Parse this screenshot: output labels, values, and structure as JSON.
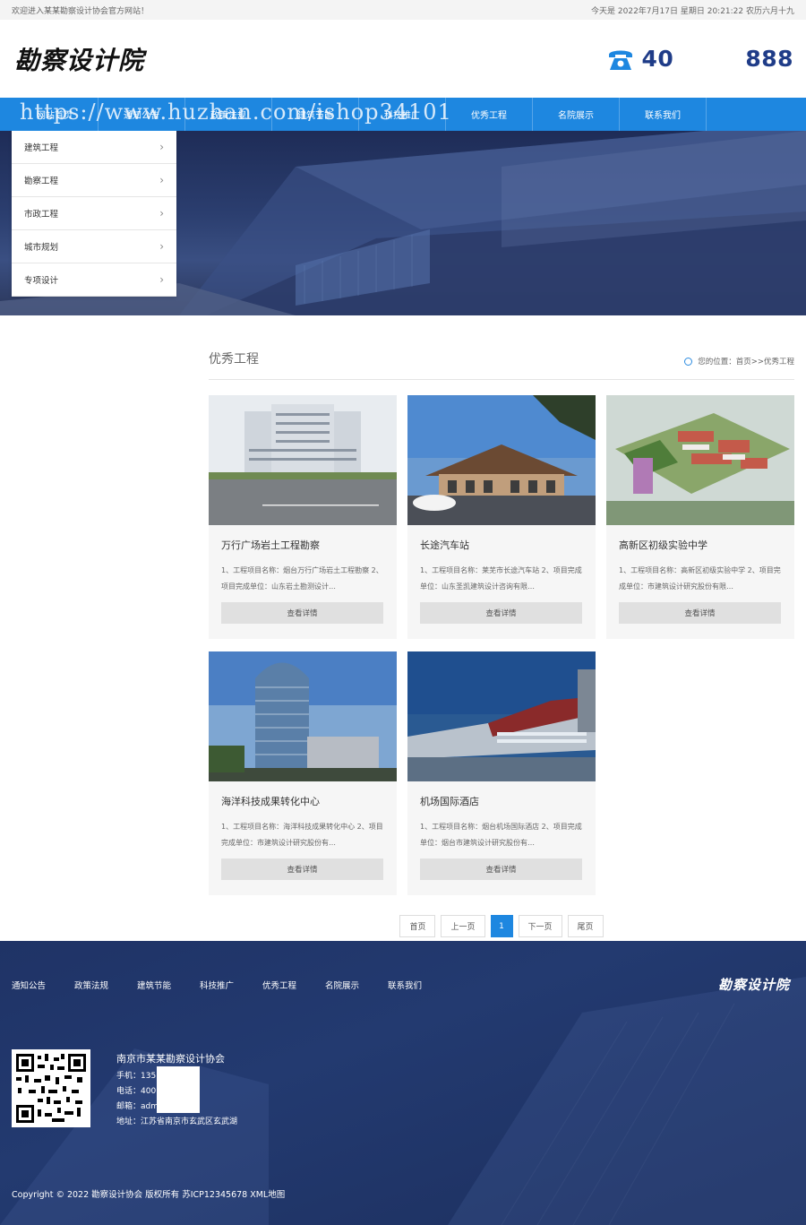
{
  "topbar": {
    "welcome": "欢迎进入某某勘察设计协会官方网站！",
    "date": "今天是 2022年7月17日 星期日 20:21:22 农历六月十九"
  },
  "header": {
    "logo": "勘察设计院",
    "phone_prefix": "40",
    "phone_suffix": "888",
    "phone_icon": "phone-icon"
  },
  "nav": {
    "items": [
      "网站首页",
      "通知公告",
      "政策法规",
      "建筑节能",
      "科技推广",
      "优秀工程",
      "名院展示",
      "联系我们"
    ],
    "watermark": "https://www.huzhan.com/ishop34101"
  },
  "side_menu": {
    "items": [
      "建筑工程",
      "勘察工程",
      "市政工程",
      "城市规划",
      "专项设计"
    ]
  },
  "section": {
    "title": "优秀工程",
    "breadcrumb": "您的位置：首页>>优秀工程"
  },
  "projects": [
    {
      "title": "万行广场岩土工程勘察",
      "desc": "1、工程项目名称：烟台万行广场岩土工程勘察 2、项目完成单位：山东岩土勘测设计…",
      "button": "查看详情"
    },
    {
      "title": "长途汽车站",
      "desc": "1、工程项目名称：莱芜市长途汽车站 2、项目完成单位：山东圣凯建筑设计咨询有限…",
      "button": "查看详情"
    },
    {
      "title": "高新区初级实验中学",
      "desc": "1、工程项目名称：高新区初级实验中学 2、项目完成单位：市建筑设计研究股份有限…",
      "button": "查看详情"
    },
    {
      "title": "海洋科技成果转化中心",
      "desc": "1、工程项目名称：海洋科技成果转化中心 2、项目完成单位：市建筑设计研究股份有…",
      "button": "查看详情"
    },
    {
      "title": "机场国际酒店",
      "desc": "1、工程项目名称：烟台机场国际酒店 2、项目完成单位：烟台市建筑设计研究股份有…",
      "button": "查看详情"
    }
  ],
  "pager": {
    "first": "首页",
    "prev": "上一页",
    "current": "1",
    "next": "下一页",
    "last": "尾页"
  },
  "footer": {
    "nav": [
      "通知公告",
      "政策法规",
      "建筑节能",
      "科技推广",
      "优秀工程",
      "名院展示",
      "联系我们"
    ],
    "logo": "勘察设计院",
    "org": "南京市某某勘察设计协会",
    "mobile": "手机：135          8",
    "tel": "电话：400          8",
    "email": "邮箱：adm          in.com",
    "address": "地址：江苏省南京市玄武区玄武湖",
    "copyright": "Copyright © 2022 勘察设计协会 版权所有  苏ICP12345678  XML地图"
  },
  "colors": {
    "nav_blue": "#1e87e0",
    "footer_navy": "#1f3366"
  }
}
